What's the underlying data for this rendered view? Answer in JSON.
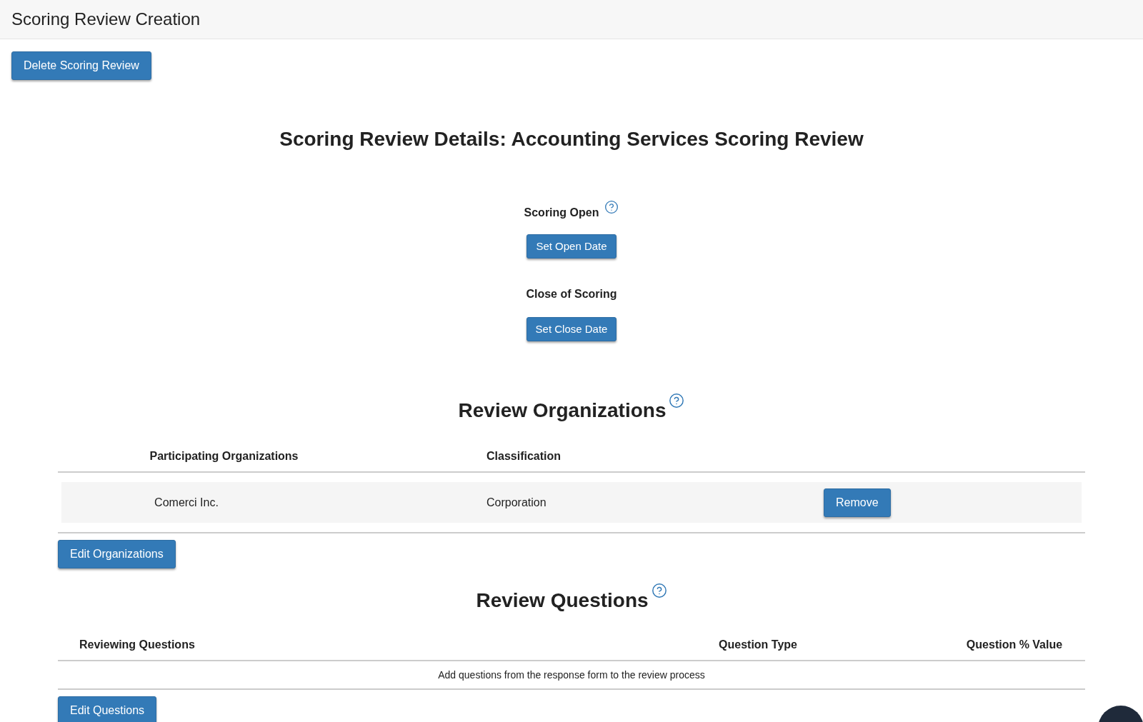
{
  "page_title": "Scoring Review Creation",
  "delete_button": "Delete Scoring Review",
  "details_title": "Scoring Review Details: Accounting Services Scoring Review",
  "scoring_open": {
    "label": "Scoring Open",
    "button": "Set Open Date"
  },
  "close_of_scoring": {
    "label": "Close of Scoring",
    "button": "Set Close Date"
  },
  "organizations": {
    "title": "Review Organizations",
    "columns": [
      "Participating Organizations",
      "Classification"
    ],
    "rows": [
      {
        "name": "Comerci Inc.",
        "classification": "Corporation",
        "action": "Remove"
      }
    ],
    "edit_button": "Edit Organizations"
  },
  "questions": {
    "title": "Review Questions",
    "columns": [
      "Reviewing Questions",
      "Question Type",
      "Question % Value"
    ],
    "empty_message": "Add questions from the response form to the review process",
    "edit_button": "Edit Questions"
  }
}
